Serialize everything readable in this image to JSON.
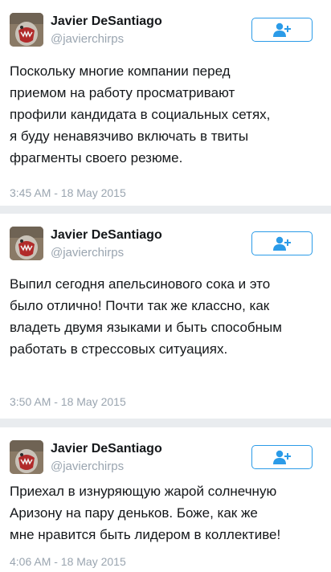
{
  "colors": {
    "accent": "#2b9be8",
    "muted": "#9aa5b0",
    "text": "#14171a"
  },
  "icons": {
    "follow": "add-user-icon",
    "avatar": "user-avatar"
  },
  "tweets": [
    {
      "name": "Javier DeSantiago",
      "handle": "@javierchirps",
      "lines": [
        "Поскольку многие компании перед",
        "приемом на работу просматривают",
        "профили кандидата в социальных сетях,",
        "я буду ненавязчиво включать в твиты",
        "фрагменты своего резюме."
      ],
      "time": "3:45 AM - 18 May 2015"
    },
    {
      "name": "Javier DeSantiago",
      "handle": "@javierchirps",
      "lines": [
        "Выпил сегодня апельсинового сока и это",
        "было отлично! Почти так же классно, как",
        "владеть двумя языками и быть способным",
        "работать в стрессовых ситуациях."
      ],
      "time": "3:50 AM - 18 May 2015"
    },
    {
      "name": "Javier DeSantiago",
      "handle": "@javierchirps",
      "lines": [
        "Приехал в изнуряющую жарой солнечную",
        "Аризону на пару деньков. Боже, как же",
        "мне нравится быть лидером в коллективе!"
      ],
      "time": "4:06 AM - 18 May 2015"
    }
  ]
}
